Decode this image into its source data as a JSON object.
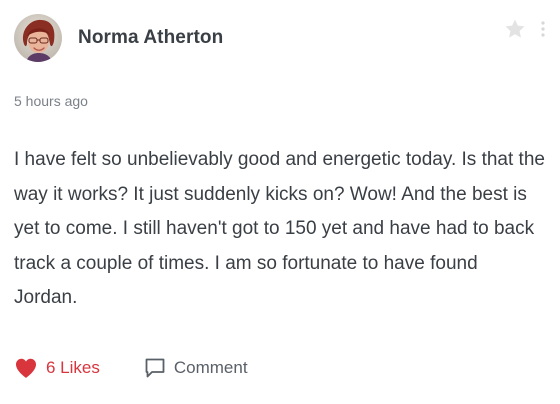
{
  "post": {
    "author": "Norma Atherton",
    "timestamp": "5 hours ago",
    "body": "I have felt so unbelievably good and energetic today. Is that the way it works? It just suddenly kicks on? Wow! And the best is yet to come. I still haven't got to 150 yet and have had to back track a couple of times. I am so fortunate to have found Jordan.",
    "likes_label": "6 Likes",
    "comment_label": "Comment",
    "favorited": false
  },
  "icons": {
    "avatar": "avatar",
    "star": "star-icon",
    "more": "more-vertical-icon",
    "like": "heart-icon",
    "comment": "comment-icon"
  },
  "colors": {
    "like_accent": "#d8353d",
    "star_inactive": "#e3e3e3",
    "text": "#3a3f45",
    "muted": "#7b8189"
  }
}
